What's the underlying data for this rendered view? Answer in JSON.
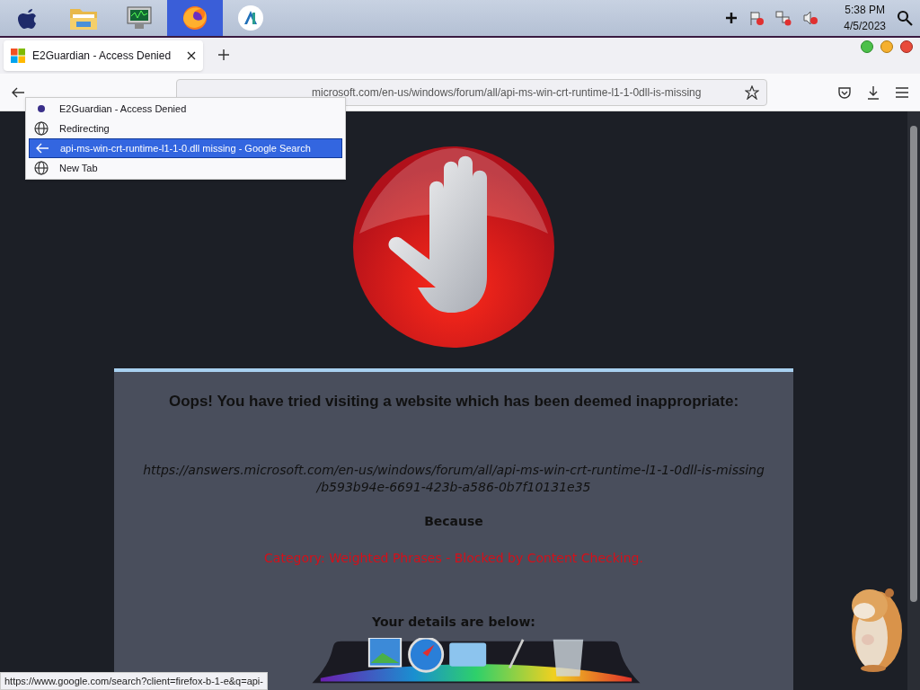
{
  "taskbar": {
    "apps": [
      {
        "kind": "apple",
        "selected": false
      },
      {
        "kind": "folder",
        "selected": false
      },
      {
        "kind": "monitor",
        "selected": false
      },
      {
        "kind": "firefox",
        "selected": true
      },
      {
        "kind": "studio",
        "selected": false
      }
    ],
    "clock": {
      "time": "5:38 PM",
      "date": "4/5/2023"
    }
  },
  "browser": {
    "tabs": [
      {
        "title": "E2Guardian - Access Denied",
        "selected": true
      }
    ],
    "address": {
      "url": "microsoft.com/en-us/windows/forum/all/api-ms-win-crt-runtime-l1-1-0dll-is-missing"
    },
    "history_menu": [
      {
        "kind": "dot",
        "label": "E2Guardian - Access Denied",
        "selected": false
      },
      {
        "kind": "globe",
        "label": "Redirecting",
        "selected": false
      },
      {
        "kind": "back",
        "label": "api-ms-win-crt-runtime-l1-1-0.dll missing - Google Search",
        "selected": true
      },
      {
        "kind": "globe",
        "label": "New Tab",
        "selected": false
      }
    ],
    "status_link": "https://www.google.com/search?client=firefox-b-1-e&q=api-"
  },
  "page": {
    "heading": "Oops! You have tried visiting a website which has been deemed inappropriate:",
    "blocked_url": [
      "https://answers.microsoft.com/en-us/windows/forum/all/api-ms-win-crt-runtime-l1-1-0dll-is-missing",
      "/b593b94e-6691-423b-a586-0b7f10131e35"
    ],
    "because": "Because",
    "reason": "Category: Weighted Phrases - Blocked by Content Checking.",
    "details_heading": "Your details are below:"
  }
}
